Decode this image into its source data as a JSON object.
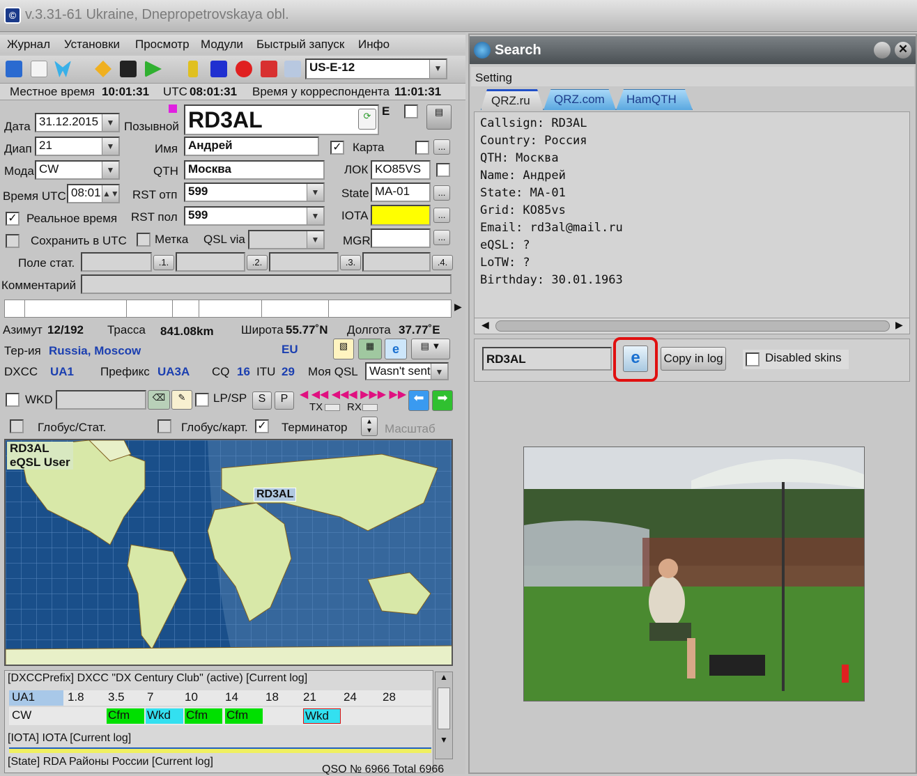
{
  "window": {
    "title": "v.3.31-61 Ukraine, Dnepropetrovskaya obl."
  },
  "menu": [
    "Журнал",
    "Установки",
    "Просмотр",
    "Модули",
    "Быстрый запуск",
    "Инфо"
  ],
  "toolbar": {
    "station": "US-E-12"
  },
  "timebar": {
    "local_label": "Местное время",
    "local": "10:01:31",
    "utc_label": "UTC",
    "utc": "08:01:31",
    "corr_label": "Время у корреспондента",
    "corr": "11:01:31"
  },
  "form": {
    "date_label": "Дата",
    "date": "31.12.2015",
    "band_label": "Диап",
    "band": "21",
    "mode_label": "Мода",
    "mode": "CW",
    "utc_time_label": "Время UTC",
    "utc_time": "08:01",
    "realtime_label": "Реальное время",
    "save_utc_label": "Сохранить в UTC",
    "callsign_label": "Позывной",
    "callsign": "RD3AL",
    "e_label": "E",
    "name_label": "Имя",
    "name": "Андрей",
    "qth_label": "QTH",
    "qth": "Москва",
    "rst_sent_label": "RST отп",
    "rst_sent": "599",
    "rst_rcvd_label": "RST пол",
    "rst_rcvd": "599",
    "mark_label": "Метка",
    "qsl_via_label": "QSL via",
    "qsl_via": "",
    "map_label": "Карта",
    "loc_label": "ЛОК",
    "loc": "KO85VS",
    "state_label": "State",
    "state": "MA-01",
    "iota_label": "IOTA",
    "iota": "",
    "mgr_label": "MGR",
    "mgr": "",
    "pole_label": "Поле стат.",
    "pole_buttons": [
      ".1.",
      ".2.",
      ".3.",
      ".4."
    ],
    "comment_label": "Комментарий"
  },
  "info": {
    "azimuth_label": "Азимут",
    "azimuth": "12/192",
    "path_label": "Трасса",
    "path": "841.08km",
    "lat_label": "Широта",
    "lat": "55.77˚N",
    "lon_label": "Долгота",
    "lon": "37.77˚E",
    "territory_label": "Тер-ия",
    "territory": "Russia, Moscow",
    "continent": "EU",
    "dxcc_label": "DXCC",
    "dxcc": "UA1",
    "prefix_label": "Префикс",
    "prefix": "UA3A",
    "cq_label": "CQ",
    "cq": "16",
    "itu_label": "ITU",
    "itu": "29",
    "myqsl_label": "Моя QSL",
    "myqsl": "Wasn't sent",
    "wkd_label": "WKD",
    "lpsp_label": "LP/SP",
    "s_btn": "S",
    "p_btn": "P",
    "tx_label": "TX",
    "rx_label": "RX",
    "globe_stat_label": "Глобус/Стат.",
    "globe_map_label": "Глобус/карт.",
    "terminator_label": "Терминатор",
    "scale_label": "Масштаб"
  },
  "map": {
    "overlay_line1": "RD3AL",
    "overlay_line2": "eQSL User",
    "marker": "RD3AL"
  },
  "dxcc_table": {
    "header": "[DXCCPrefix] DXCC \"DX Century Club\" (active) [Current log]",
    "bands": [
      "UA1",
      "1.8",
      "3.5",
      "7",
      "10",
      "14",
      "18",
      "21",
      "24",
      "28"
    ],
    "row_label": "CW",
    "row": [
      "",
      "Cfm",
      "Wkd",
      "Cfm",
      "Cfm",
      "",
      "Wkd",
      "",
      ""
    ],
    "iota_header": "[IOTA] IOTA [Current log]",
    "state_header": "[State] RDA Районы России [Current log]"
  },
  "status": {
    "text": "QSO № 6966 Total 6966"
  },
  "search": {
    "title": "Search",
    "setting_label": "Setting",
    "tabs": [
      "QRZ.ru",
      "QRZ.com",
      "HamQTH"
    ],
    "lines": [
      "Callsign: RD3AL",
      "Country: Россия",
      "QTH: Москва",
      "Name: Андрей",
      "State: MA-01",
      "Grid: KO85vs",
      "Email: rd3al@mail.ru",
      "eQSL: ?",
      "LoTW: ?",
      "Birthday: 30.01.1963"
    ],
    "query": "RD3AL",
    "copy_label": "Copy in log",
    "disabled_skins_label": "Disabled skins"
  },
  "colors": {
    "accent_blue": "#1b3fb0",
    "cfm": "#00e000",
    "wkd": "#33e0f0",
    "iota_yellow": "#ffff00",
    "highlight_red": "#e01010"
  }
}
